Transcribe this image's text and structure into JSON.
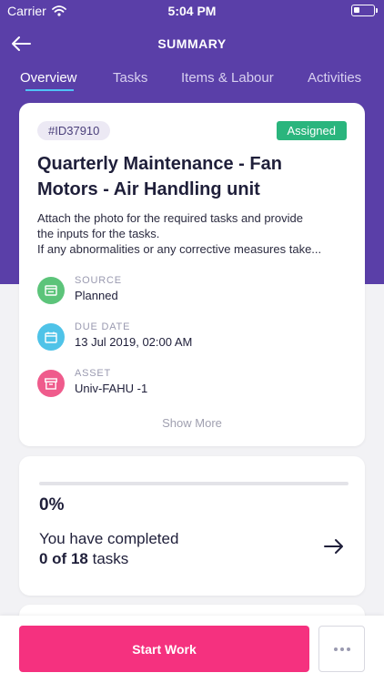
{
  "status_bar": {
    "carrier": "Carrier",
    "time": "5:04 PM"
  },
  "header": {
    "title": "SUMMARY"
  },
  "tabs": [
    {
      "label": "Overview",
      "active": true
    },
    {
      "label": "Tasks",
      "active": false
    },
    {
      "label": "Items & Labour",
      "active": false
    },
    {
      "label": "Activities",
      "active": false
    }
  ],
  "work_order": {
    "id": "#ID37910",
    "status": "Assigned",
    "title": "Quarterly Maintenance - Fan Motors - Air Handling unit",
    "description_line1": "Attach the photo for the required tasks and provide",
    "description_line2": "the inputs for the tasks.",
    "description_line3": "If any abnormalities or any corrective measures take...",
    "source_label": "SOURCE",
    "source_value": "Planned",
    "due_label": "DUE DATE",
    "due_value": "13 Jul 2019, 02:00 AM",
    "asset_label": "ASSET",
    "asset_value": "Univ-FAHU -1",
    "show_more": "Show More"
  },
  "progress": {
    "percent_text": "0%",
    "fraction": 0,
    "completed_text": "You have completed",
    "count_text": "0 of 18",
    "tasks_suffix": "tasks"
  },
  "footer": {
    "start_label": "Start Work"
  },
  "colors": {
    "primary": "#5a3fa8",
    "accent": "#f5317f",
    "status_green": "#2ab57d",
    "source_icon_bg": "#5cc47a",
    "due_icon_bg": "#4fc3e8",
    "asset_icon_bg": "#ef5b8c"
  },
  "icons": {
    "back": "arrow-left-icon",
    "wifi": "wifi-icon",
    "battery": "battery-icon",
    "source": "document-icon",
    "due": "calendar-icon",
    "asset": "archive-box-icon",
    "next": "arrow-right-icon",
    "more": "ellipsis-icon"
  }
}
